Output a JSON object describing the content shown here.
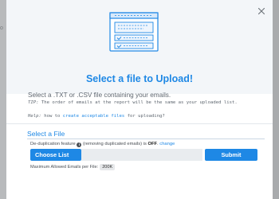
{
  "backdrop": {
    "glyph": "o"
  },
  "modal": {
    "close_icon": "close-icon",
    "illustration_icon": "document-list-icon",
    "title": "Select a file to Upload!",
    "subtitle": "Select a .TXT or .CSV file containing your emails.",
    "tip_label": "TIP:",
    "tip_text": " The order of emails at the report will be the same as your uploaded list.",
    "help_label": "Help:",
    "help_prefix": " how to ",
    "help_link": "create acceptable files",
    "help_suffix": " for uploading?",
    "section_title": "Select a File",
    "dedup_prefix": "De-duplication feature ",
    "dedup_middle": " (removing duplicated emails) is ",
    "dedup_status": "OFF",
    "dedup_sep": ".",
    "dedup_change": "change",
    "choose_label": "Choose List",
    "file_value": "",
    "submit_label": "Submit",
    "max_label": "Maximum Allowed Emails per File:",
    "max_value": "200K"
  },
  "colors": {
    "accent": "#1e88e5",
    "backdrop": "#a9abad"
  }
}
